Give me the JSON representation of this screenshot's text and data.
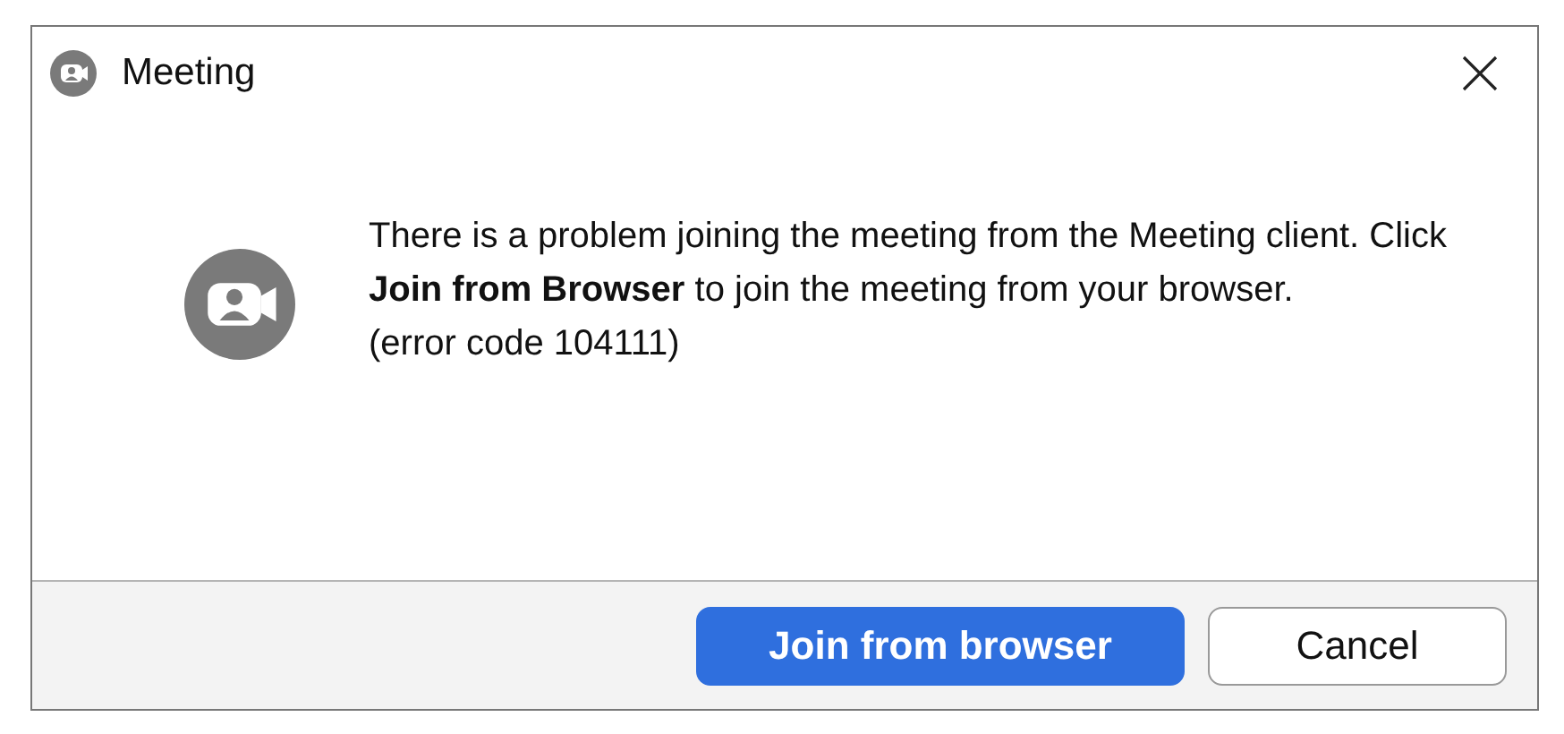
{
  "window": {
    "title": "Meeting"
  },
  "message": "There is a problem joining the meeting from the Meeting client. Click **Join from Browser** to join the meeting from your browser.",
  "error_code": "(error code 104111)",
  "buttons": [
    {
      "label": "Join from browser",
      "kind": "primary"
    },
    {
      "label": "Cancel",
      "kind": "secondary"
    }
  ]
}
